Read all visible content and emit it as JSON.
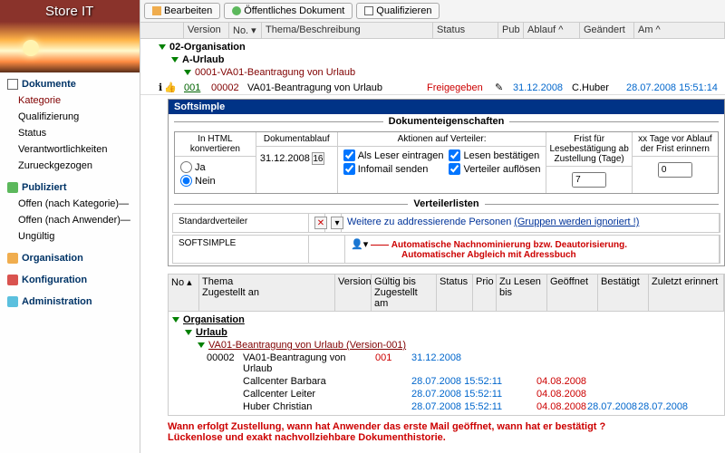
{
  "app_title": "Store IT",
  "toolbar": {
    "edit": "Bearbeiten",
    "public_doc": "Öffentliches Dokument",
    "qualify": "Qualifizieren"
  },
  "grid_columns": {
    "version": "Version",
    "no": "No.",
    "thema": "Thema/Beschreibung",
    "status": "Status",
    "pub": "Pub",
    "ablauf": "Ablauf",
    "geaendert": "Geändert",
    "am": "Am"
  },
  "nav": {
    "dokumente": "Dokumente",
    "kategorie": "Kategorie",
    "qualifizierung": "Qualifizierung",
    "status": "Status",
    "verantwortlich": "Verantwortlichkeiten",
    "zurueck": "Zurueckgezogen",
    "publiziert": "Publiziert",
    "offen_kat": "Offen (nach Kategorie)",
    "offen_anw": "Offen (nach Anwender)",
    "ungueltig": "Ungültig",
    "organisation": "Organisation",
    "konfiguration": "Konfiguration",
    "administration": "Administration"
  },
  "tree": {
    "org": "02-Organisation",
    "urlaub": "A-Urlaub",
    "doc": "0001-VA01-Beantragung von Urlaub"
  },
  "doc_row": {
    "version": "001",
    "no": "00002",
    "thema": "VA01-Beantragung von Urlaub",
    "status": "Freigegeben",
    "ablauf": "31.12.2008",
    "geaendert": "C.Huber",
    "am": "28.07.2008 15:51:14"
  },
  "detail": {
    "title": "Softsimple",
    "section_props": "Dokumenteigenschaften",
    "section_vert": "Verteilerlisten",
    "col_html": "In HTML konvertieren",
    "col_ablauf": "Dokumentablauf",
    "col_aktionen": "Aktionen auf Verteiler:",
    "col_frist": "Frist für Lesebestätigung ab Zustellung (Tage)",
    "col_erinnern": "xx Tage vor Ablauf der Frist erinnern",
    "radio_ja": "Ja",
    "radio_nein": "Nein",
    "ablauf_val": "31.12.2008",
    "chk_leser": "Als Leser eintragen",
    "chk_lesen": "Lesen bestätigen",
    "chk_infomail": "Infomail senden",
    "chk_aufloesen": "Verteiler auflösen",
    "frist_val": "7",
    "erinnern_val": "0",
    "std_verteiler": "Standardverteiler",
    "weitere": "Weitere zu addressierende Personen",
    "gruppen_hint": "(Gruppen werden ignoriert !)",
    "softsimple": "SOFTSIMPLE",
    "annot1": "Automatische Nachnominierung bzw. Deautorisierung.",
    "annot2": "Automatischer Abgleich mit Adressbuch"
  },
  "hist": {
    "col_no": "No",
    "col_thema": "Thema",
    "col_zugestellt": "Zugestellt an",
    "col_version": "Version",
    "col_gueltig": "Gültig bis",
    "col_zugestellt_am": "Zugestellt am",
    "col_status": "Status",
    "col_prio": "Prio",
    "col_zulesen": "Zu Lesen bis",
    "col_geoeffnet": "Geöffnet",
    "col_bestaetigt": "Bestätigt",
    "col_zuletzt": "Zuletzt erinnert",
    "org": "Organisation",
    "urlaub": "Urlaub",
    "doc_link": "VA01-Beantragung von Urlaub (Version-001)",
    "row_no": "00002",
    "row_thema": "VA01-Beantragung von Urlaub",
    "row_ver": "001",
    "row_gueltig": "31.12.2008",
    "p1_name": "Callcenter Barbara",
    "p1_zug": "28.07.2008 15:52:11",
    "p1_lesen": "04.08.2008",
    "p2_name": "Callcenter Leiter",
    "p2_zug": "28.07.2008 15:52:11",
    "p2_lesen": "04.08.2008",
    "p3_name": "Huber Christian",
    "p3_zug": "28.07.2008 15:52:11",
    "p3_lesen": "04.08.2008",
    "p3_open": "28.07.2008",
    "p3_best": "28.07.2008"
  },
  "bottom_annot": {
    "l1": "Wann erfolgt Zustellung, wann hat Anwender das erste Mail geöffnet, wann hat er bestätigt ?",
    "l2": "Lückenlose und exakt nachvollziehbare Dokumenthistorie."
  }
}
